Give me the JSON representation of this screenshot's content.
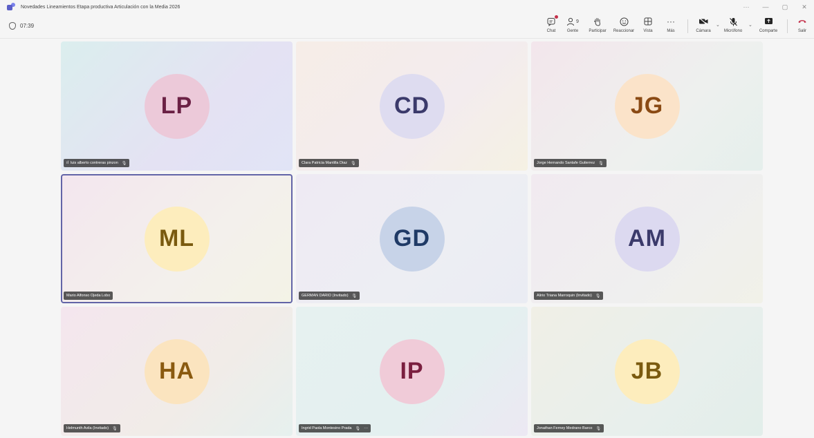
{
  "window": {
    "title": "Novedades Lineamientos Etapa productiva Articulación con la Media 2026",
    "controls": [
      "···",
      "—",
      "▢",
      "✕"
    ]
  },
  "toolbar": {
    "timer": "07:39",
    "chat_label": "Chat",
    "people_label": "Gente",
    "people_count": "9",
    "raise_label": "Participar",
    "react_label": "Reaccionar",
    "view_label": "Vista",
    "more_label": "Más",
    "camera_label": "Cámara",
    "mic_label": "Micrófono",
    "share_label": "Comparte",
    "leave_label": "Salir"
  },
  "colors": {
    "accent": "#6264a7",
    "leave": "#c4314b"
  },
  "participants": [
    {
      "initials": "LP",
      "name": "luis alberto contreras pinzon",
      "avatar_bg": "#ecc9d9",
      "avatar_fg": "#6b2145",
      "tile_bg": "linear-gradient(135deg,#dbeeee 0%,#e4e2f3 60%,#e1e4f6 100%)"
    },
    {
      "initials": "CD",
      "name": "Clara Patricia Mantilla Diaz",
      "avatar_bg": "#dedcf0",
      "avatar_fg": "#3b3a6b",
      "tile_bg": "linear-gradient(135deg,#f6ede7 0%,#f3ecee 60%,#f5f1e3 100%)"
    },
    {
      "initials": "JG",
      "name": "Jorge Hernando Santafe Gutierrez",
      "avatar_bg": "#fbe3c9",
      "avatar_fg": "#8a4a14",
      "tile_bg": "linear-gradient(135deg,#f3e6ec 0%,#eef0ee 60%,#e5efec 100%)"
    },
    {
      "initials": "ML",
      "name": "Mario Alfonso Ojeda Lobo",
      "avatar_bg": "#fdedbd",
      "avatar_fg": "#7a5a0f",
      "tile_bg": "linear-gradient(135deg,#f3e6ee 0%,#f3f0ec 60%,#f3f3e6 100%)"
    },
    {
      "initials": "GD",
      "name": "GERMAN DARIO (Invitado)",
      "avatar_bg": "#c7d3e8",
      "avatar_fg": "#1f3a66",
      "tile_bg": "linear-gradient(135deg,#eeeaf3 0%,#edeef3 60%,#eaecf3 100%)"
    },
    {
      "initials": "AM",
      "name": "Alirio Triana Marroquin (Invitado)",
      "avatar_bg": "#dcd9f0",
      "avatar_fg": "#3b3a6b",
      "tile_bg": "linear-gradient(135deg,#f1eaf0 0%,#efefef 60%,#f1f1e8 100%)"
    },
    {
      "initials": "HA",
      "name": "Helmunth Avila (Invitado)",
      "avatar_bg": "#fbe4bf",
      "avatar_fg": "#8a5a10",
      "tile_bg": "linear-gradient(135deg,#f4e6ee 0%,#f1ece8 60%,#e6f0ee 100%)"
    },
    {
      "initials": "IP",
      "name": "Ingrid Paola Montesino Prada",
      "avatar_bg": "#f0cbd8",
      "avatar_fg": "#7a1f3f",
      "tile_bg": "linear-gradient(135deg,#e6f1f0 0%,#e4f0f0 60%,#ece8f3 100%)"
    },
    {
      "initials": "JB",
      "name": "Jonathan Ferney Medrano Barco",
      "avatar_bg": "#fdedbd",
      "avatar_fg": "#7a5a0f",
      "tile_bg": "linear-gradient(135deg,#f0efe6 0%,#e8efec 60%,#e2eeea 100%)"
    }
  ]
}
